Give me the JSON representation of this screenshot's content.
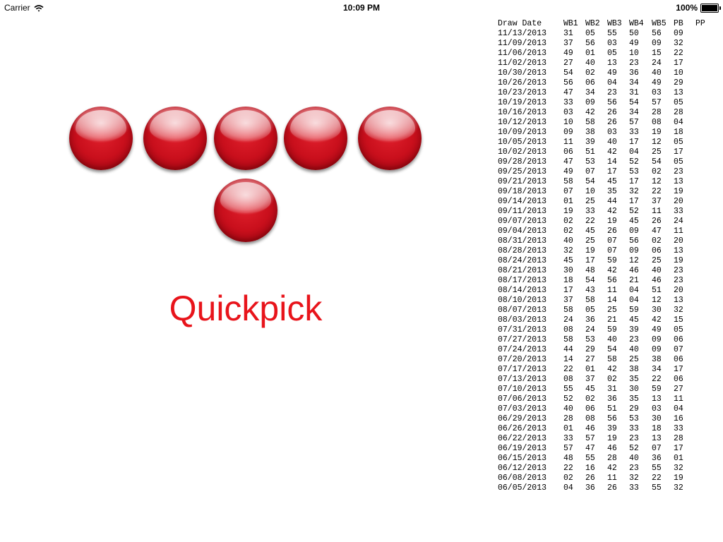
{
  "status_bar": {
    "carrier": "Carrier",
    "time": "10:09 PM",
    "battery": "100%"
  },
  "balls": [
    "",
    "",
    "",
    "",
    "",
    ""
  ],
  "quickpick_label": "Quickpick",
  "history": {
    "headers": [
      "Draw Date",
      "WB1",
      "WB2",
      "WB3",
      "WB4",
      "WB5",
      "PB",
      "PP"
    ],
    "rows": [
      [
        "11/13/2013",
        "31",
        "05",
        "55",
        "50",
        "56",
        "09",
        ""
      ],
      [
        "11/09/2013",
        "37",
        "56",
        "03",
        "49",
        "09",
        "32",
        ""
      ],
      [
        "11/06/2013",
        "49",
        "01",
        "05",
        "10",
        "15",
        "22",
        ""
      ],
      [
        "11/02/2013",
        "27",
        "40",
        "13",
        "23",
        "24",
        "17",
        ""
      ],
      [
        "10/30/2013",
        "54",
        "02",
        "49",
        "36",
        "40",
        "10",
        ""
      ],
      [
        "10/26/2013",
        "56",
        "06",
        "04",
        "34",
        "49",
        "29",
        ""
      ],
      [
        "10/23/2013",
        "47",
        "34",
        "23",
        "31",
        "03",
        "13",
        ""
      ],
      [
        "10/19/2013",
        "33",
        "09",
        "56",
        "54",
        "57",
        "05",
        ""
      ],
      [
        "10/16/2013",
        "03",
        "42",
        "26",
        "34",
        "28",
        "28",
        ""
      ],
      [
        "10/12/2013",
        "10",
        "58",
        "26",
        "57",
        "08",
        "04",
        ""
      ],
      [
        "10/09/2013",
        "09",
        "38",
        "03",
        "33",
        "19",
        "18",
        ""
      ],
      [
        "10/05/2013",
        "11",
        "39",
        "40",
        "17",
        "12",
        "05",
        ""
      ],
      [
        "10/02/2013",
        "06",
        "51",
        "42",
        "04",
        "25",
        "17",
        ""
      ],
      [
        "09/28/2013",
        "47",
        "53",
        "14",
        "52",
        "54",
        "05",
        ""
      ],
      [
        "09/25/2013",
        "49",
        "07",
        "17",
        "53",
        "02",
        "23",
        ""
      ],
      [
        "09/21/2013",
        "58",
        "54",
        "45",
        "17",
        "12",
        "13",
        ""
      ],
      [
        "09/18/2013",
        "07",
        "10",
        "35",
        "32",
        "22",
        "19",
        ""
      ],
      [
        "09/14/2013",
        "01",
        "25",
        "44",
        "17",
        "37",
        "20",
        ""
      ],
      [
        "09/11/2013",
        "19",
        "33",
        "42",
        "52",
        "11",
        "33",
        ""
      ],
      [
        "09/07/2013",
        "02",
        "22",
        "19",
        "45",
        "26",
        "24",
        ""
      ],
      [
        "09/04/2013",
        "02",
        "45",
        "26",
        "09",
        "47",
        "11",
        ""
      ],
      [
        "08/31/2013",
        "40",
        "25",
        "07",
        "56",
        "02",
        "20",
        ""
      ],
      [
        "08/28/2013",
        "32",
        "19",
        "07",
        "09",
        "06",
        "13",
        ""
      ],
      [
        "08/24/2013",
        "45",
        "17",
        "59",
        "12",
        "25",
        "19",
        ""
      ],
      [
        "08/21/2013",
        "30",
        "48",
        "42",
        "46",
        "40",
        "23",
        ""
      ],
      [
        "08/17/2013",
        "18",
        "54",
        "56",
        "21",
        "46",
        "23",
        ""
      ],
      [
        "08/14/2013",
        "17",
        "43",
        "11",
        "04",
        "51",
        "20",
        ""
      ],
      [
        "08/10/2013",
        "37",
        "58",
        "14",
        "04",
        "12",
        "13",
        ""
      ],
      [
        "08/07/2013",
        "58",
        "05",
        "25",
        "59",
        "30",
        "32",
        ""
      ],
      [
        "08/03/2013",
        "24",
        "36",
        "21",
        "45",
        "42",
        "15",
        ""
      ],
      [
        "07/31/2013",
        "08",
        "24",
        "59",
        "39",
        "49",
        "05",
        ""
      ],
      [
        "07/27/2013",
        "58",
        "53",
        "40",
        "23",
        "09",
        "06",
        ""
      ],
      [
        "07/24/2013",
        "44",
        "29",
        "54",
        "40",
        "09",
        "07",
        ""
      ],
      [
        "07/20/2013",
        "14",
        "27",
        "58",
        "25",
        "38",
        "06",
        ""
      ],
      [
        "07/17/2013",
        "22",
        "01",
        "42",
        "38",
        "34",
        "17",
        ""
      ],
      [
        "07/13/2013",
        "08",
        "37",
        "02",
        "35",
        "22",
        "06",
        ""
      ],
      [
        "07/10/2013",
        "55",
        "45",
        "31",
        "30",
        "59",
        "27",
        ""
      ],
      [
        "07/06/2013",
        "52",
        "02",
        "36",
        "35",
        "13",
        "11",
        ""
      ],
      [
        "07/03/2013",
        "40",
        "06",
        "51",
        "29",
        "03",
        "04",
        ""
      ],
      [
        "06/29/2013",
        "28",
        "08",
        "56",
        "53",
        "30",
        "16",
        ""
      ],
      [
        "06/26/2013",
        "01",
        "46",
        "39",
        "33",
        "18",
        "33",
        ""
      ],
      [
        "06/22/2013",
        "33",
        "57",
        "19",
        "23",
        "13",
        "28",
        ""
      ],
      [
        "06/19/2013",
        "57",
        "47",
        "46",
        "52",
        "07",
        "17",
        ""
      ],
      [
        "06/15/2013",
        "48",
        "55",
        "28",
        "40",
        "36",
        "01",
        ""
      ],
      [
        "06/12/2013",
        "22",
        "16",
        "42",
        "23",
        "55",
        "32",
        ""
      ],
      [
        "06/08/2013",
        "02",
        "26",
        "11",
        "32",
        "22",
        "19",
        ""
      ],
      [
        "06/05/2013",
        "04",
        "36",
        "26",
        "33",
        "55",
        "32",
        ""
      ]
    ]
  }
}
